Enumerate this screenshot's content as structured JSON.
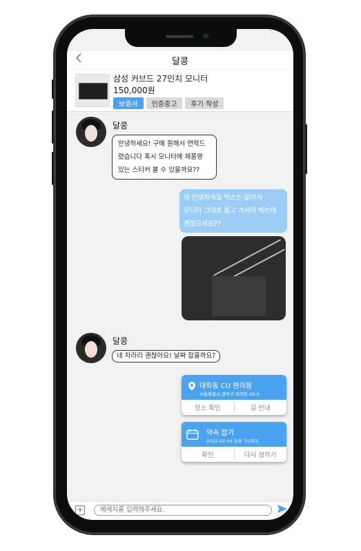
{
  "header": {
    "back_icon": "chevron-left-icon",
    "title": "달콩"
  },
  "product": {
    "name": "삼성 커브드 27인치 모니터",
    "price": "150,000원",
    "tags": [
      "보증서",
      "인증중고",
      "후기 작성"
    ]
  },
  "messages": {
    "m1": {
      "sender": "달콩",
      "lines": [
        "안녕하세요! 구매 원해서 연락드",
        "렸습니다 혹시 모니터에 제품명",
        "있는 스티커 볼 수 있을까요??"
      ]
    },
    "m2": {
      "lines": [
        "아 안녕하세요 박스는 없어서",
        "모니터 그대로 들고 가서야 하는데",
        "괜찮으세요??"
      ]
    },
    "m3": {
      "sender": "달콩",
      "text": "네 차라리 괜찮아요! 날짜 잡을까요?"
    }
  },
  "location_card": {
    "icon": "map-pin-icon",
    "title": "대학동 CU 편의점",
    "address": "서울특별시 관악구 대학동 00-0",
    "actions": [
      "장소 확인",
      "길 안내"
    ]
  },
  "appointment_card": {
    "icon": "calendar-icon",
    "title": "약속 잡기",
    "datetime": "2022-02-04 오후 7시까지",
    "actions": [
      "확인",
      "다시 정하기"
    ]
  },
  "input": {
    "placeholder": "메세지를 입력해주세요.",
    "plus_icon": "plus-square-icon",
    "send_icon": "send-icon"
  },
  "colors": {
    "accent": "#4aa3f0",
    "outgoing_bubble": "#9ccdf6",
    "chat_bg": "#f1f1f1"
  }
}
